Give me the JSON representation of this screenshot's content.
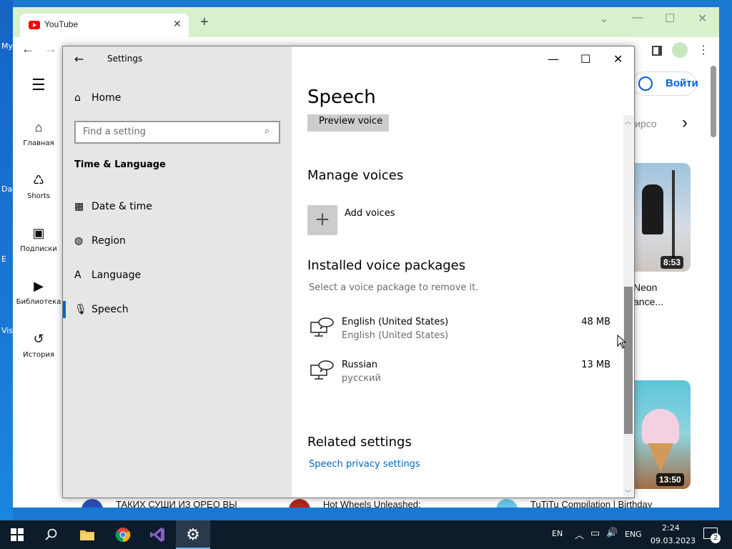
{
  "desktop": {
    "icon_labels": [
      "My",
      "Da",
      "E",
      "Vis"
    ]
  },
  "browser": {
    "tab_title": "YouTube",
    "tab_close": "✕",
    "new_tab": "+",
    "minimize": "—",
    "maximize": "☐",
    "close": "✕",
    "chevron": "⌄",
    "back": "←",
    "forward": "→",
    "menu": "⋮"
  },
  "youtube": {
    "hamburger": "☰",
    "sidebar": [
      {
        "label": "Главная",
        "icon": "⌂"
      },
      {
        "label": "Shorts",
        "icon": "♺"
      },
      {
        "label": "Подписки",
        "icon": "▣"
      },
      {
        "label": "Библиотека",
        "icon": "▶"
      },
      {
        "label": "История",
        "icon": "↺"
      }
    ],
    "signin_label": "Войти",
    "chip_fragment": "ирсо",
    "chip_next": "›",
    "video1": {
      "duration": "8:53",
      "title_line1": "Neon",
      "title_line2": "ance..."
    },
    "video2": {
      "duration": "13:50"
    },
    "bottom_titles": [
      "ТАКИХ СУШИ ИЗ ОРЕО ВЫ",
      "Hot Wheels Unleashed:",
      "TuTiTu Compilation | Birthday"
    ]
  },
  "settings": {
    "window_title": "Settings",
    "back": "←",
    "minimize": "—",
    "maximize": "☐",
    "close": "✕",
    "home_label": "Home",
    "search_placeholder": "Find a setting",
    "group_heading": "Time & Language",
    "nav_items": [
      {
        "label": "Date & time",
        "icon": "calendar-clock-icon"
      },
      {
        "label": "Region",
        "icon": "globe-icon"
      },
      {
        "label": "Language",
        "icon": "language-icon"
      },
      {
        "label": "Speech",
        "icon": "microphone-icon"
      }
    ],
    "selected_nav": "Speech",
    "page_title": "Speech",
    "preview_voice_label": "Preview voice",
    "manage_voices_heading": "Manage voices",
    "add_voices_label": "Add voices",
    "installed_heading": "Installed voice packages",
    "installed_hint": "Select a voice package to remove it.",
    "packages": [
      {
        "name": "English (United States)",
        "sub": "English (United States)",
        "size": "48 MB"
      },
      {
        "name": "Russian",
        "sub": "русский",
        "size": "13 MB"
      }
    ],
    "related_heading": "Related settings",
    "privacy_link": "Speech privacy settings",
    "scroll_up": "︿",
    "scroll_down": "﹀"
  },
  "taskbar": {
    "apps": [
      "start",
      "search",
      "file-explorer",
      "chrome",
      "visual-studio",
      "settings"
    ],
    "lang_indicator": "EN",
    "input_lang": "ENG",
    "time": "2:24",
    "date": "09.03.2023",
    "notifications": "2",
    "tray_up": "︿",
    "tray_network": "▭",
    "tray_volume": "🔊"
  },
  "colors": {
    "accent": "#0067c0",
    "chrome_frame": "#d9f0cd",
    "taskbar": "#0d1b2a",
    "desktop": "#1a78d2"
  }
}
